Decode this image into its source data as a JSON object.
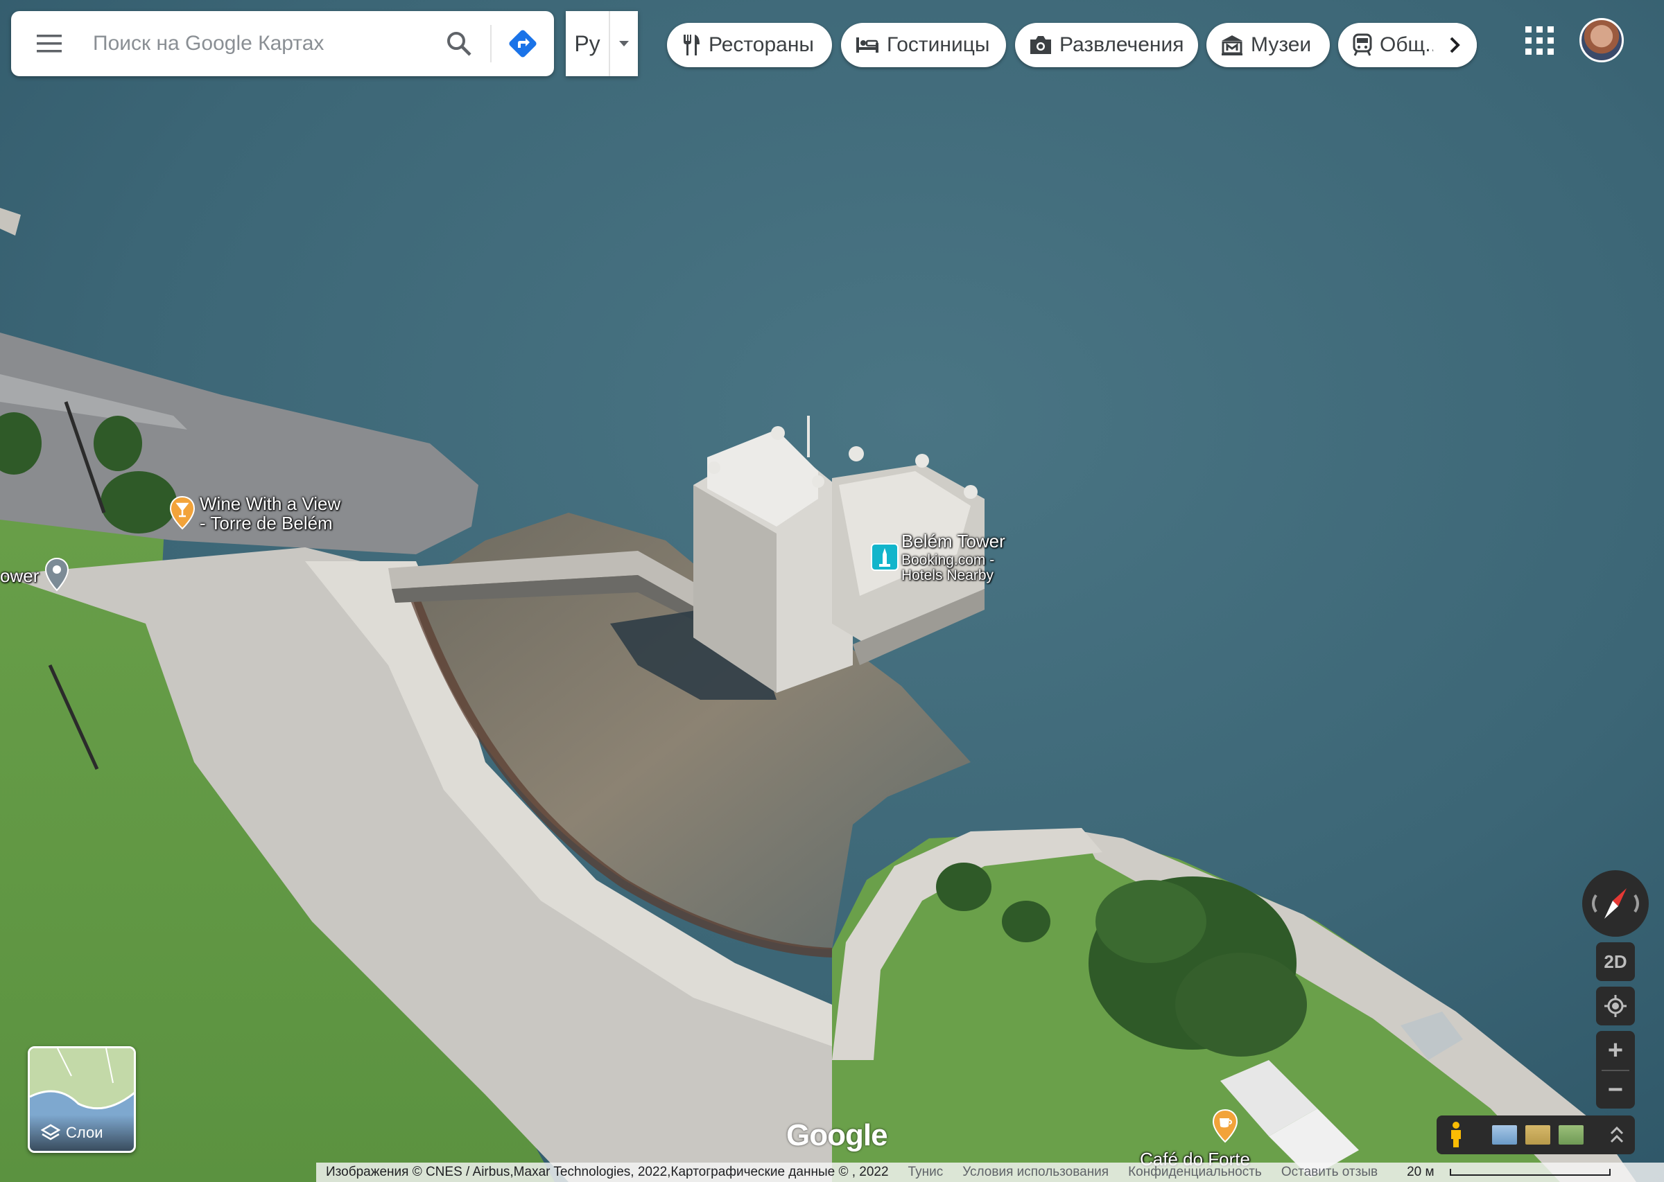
{
  "search": {
    "placeholder": "Поиск на Google Картах"
  },
  "language": {
    "label": "Ру"
  },
  "categories": [
    {
      "label": "Рестораны",
      "icon": "fork-knife-icon"
    },
    {
      "label": "Гостиницы",
      "icon": "bed-icon"
    },
    {
      "label": "Развлечения",
      "icon": "camera-icon"
    },
    {
      "label": "Музеи",
      "icon": "museum-icon"
    },
    {
      "label": "Общ...",
      "icon": "train-icon"
    }
  ],
  "places": {
    "wine": {
      "line1": "Wine With a View",
      "line2": "- Torre de Belém",
      "color": "#f2a33a"
    },
    "tower_partial": {
      "label": "ower"
    },
    "belem": {
      "title": "Belém Tower",
      "sub1": "Booking.com -",
      "sub2": "Hotels Nearby",
      "color": "#12b5cb"
    },
    "cafe": {
      "label": "Café do Forte",
      "color": "#f2a33a"
    }
  },
  "controls": {
    "view_mode": "2D",
    "zoom_in": "+",
    "zoom_out": "−"
  },
  "layers": {
    "label": "Слои"
  },
  "logo": {
    "text": "Google"
  },
  "footer": {
    "imagery": "Изображения © CNES / Airbus,Maxar Technologies, 2022,Картографические данные © , 2022",
    "country": "Тунис",
    "terms": "Условия использования",
    "privacy": "Конфиденциальность",
    "feedback": "Оставить отзыв",
    "scale": "20 м"
  }
}
